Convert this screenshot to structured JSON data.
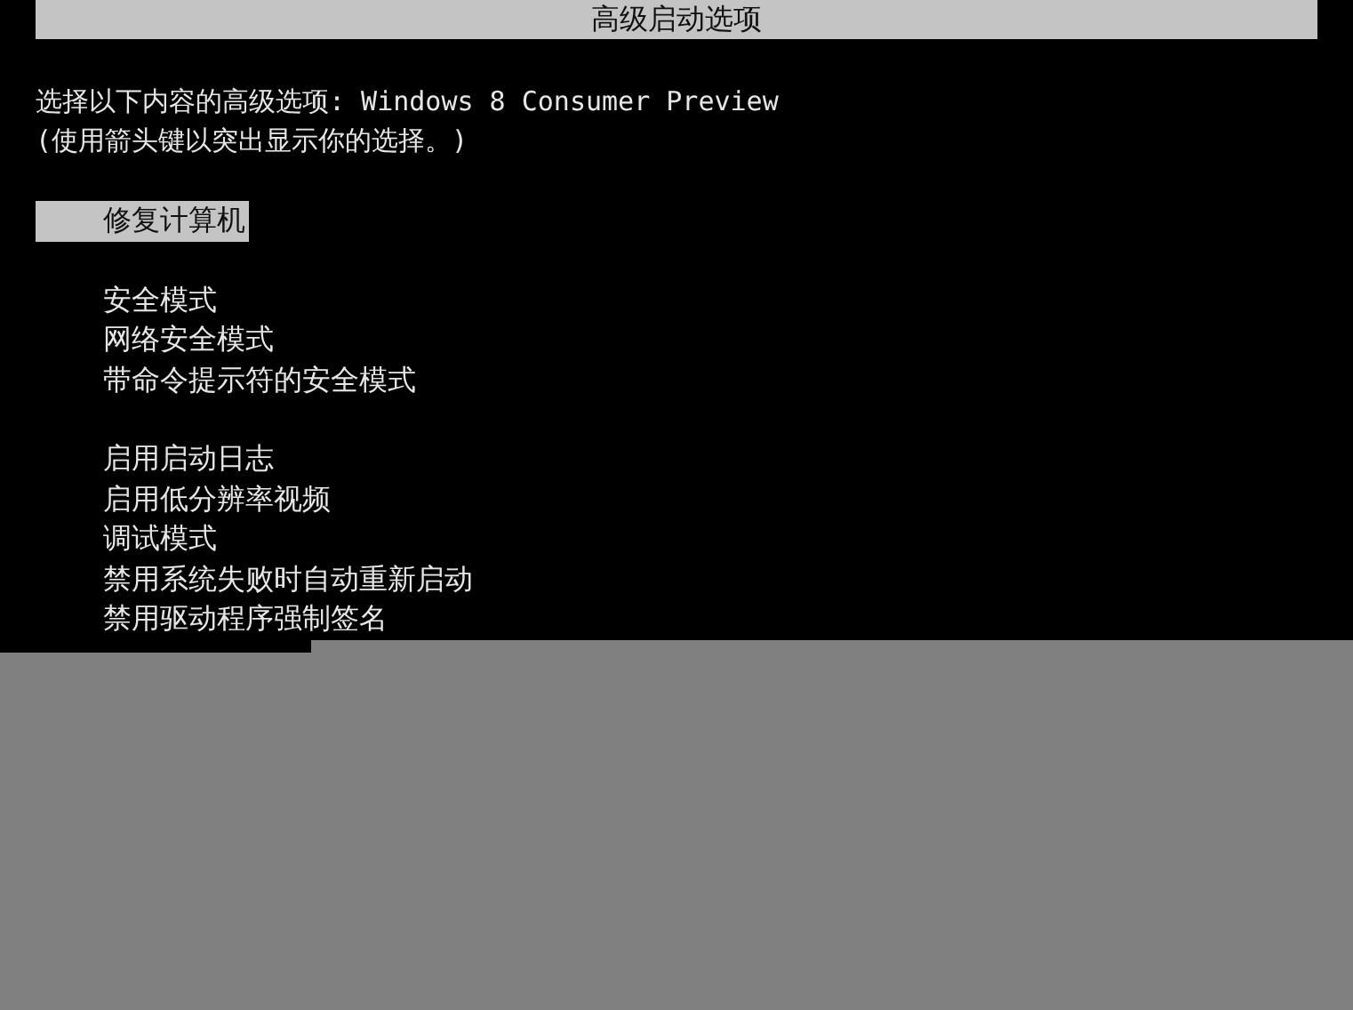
{
  "title": "高级启动选项",
  "prompt": "选择以下内容的高级选项: Windows 8 Consumer Preview",
  "hint": "(使用箭头键以突出显示你的选择。)",
  "menu_groups": [
    [
      {
        "label": "修复计算机",
        "selected": true
      }
    ],
    [
      {
        "label": "安全模式",
        "selected": false
      },
      {
        "label": "网络安全模式",
        "selected": false
      },
      {
        "label": "带命令提示符的安全模式",
        "selected": false
      }
    ],
    [
      {
        "label": "启用启动日志",
        "selected": false
      },
      {
        "label": "启用低分辨率视频",
        "selected": false
      },
      {
        "label": "调试模式",
        "selected": false
      },
      {
        "label": "禁用系统失败时自动重新启动",
        "selected": false
      },
      {
        "label": "禁用驱动程序强制签名",
        "selected": false
      }
    ]
  ]
}
